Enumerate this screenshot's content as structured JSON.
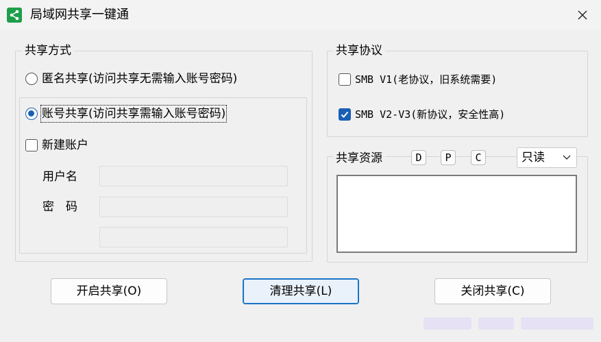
{
  "window": {
    "title": "局域网共享一键通",
    "icon": "share-icon",
    "close_glyph": "✕"
  },
  "share_mode": {
    "title": "共享方式",
    "anonymous_label": "匿名共享(访问共享无需输入账号密码)",
    "account_label": "账号共享(访问共享需输入账号密码)",
    "selected": "account",
    "new_account_label": "新建账户",
    "new_account_checked": false,
    "username_label": "用户名",
    "password_label": "密　码",
    "username_value": "",
    "password_value": "",
    "confirm_value": ""
  },
  "protocol": {
    "title": "共享协议",
    "smb_v1_label": "SMB V1(老协议，旧系统需要)",
    "smb_v1_checked": false,
    "smb_v2_label": "SMB V2-V3(新协议，安全性高)",
    "smb_v2_checked": true
  },
  "resources": {
    "title": "共享资源",
    "drives": [
      "D",
      "P",
      "C"
    ],
    "access_selected": "只读"
  },
  "buttons": {
    "open_share": "开启共享(O)",
    "clean_share": "清理共享(L)",
    "close_share": "关闭共享(C)"
  },
  "colors": {
    "accent": "#1a5fb4",
    "app_icon": "#1e9e4a"
  }
}
